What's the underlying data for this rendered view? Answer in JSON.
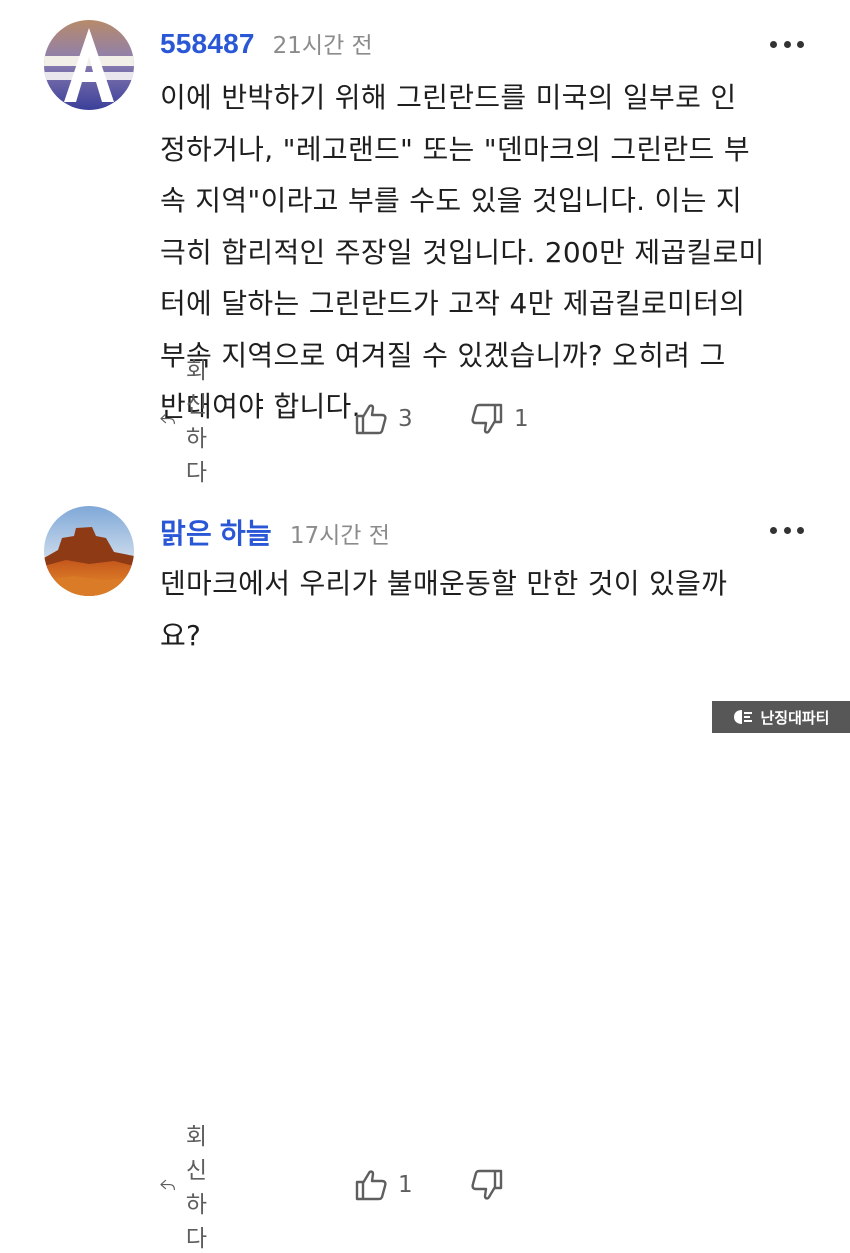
{
  "comments": [
    {
      "username": "558487",
      "time": "21시간 전",
      "text": "이에 반박하기 위해 그린란드를 미국의 일부로 인\n정하거나, \"레고랜드\" 또는 \"덴마크의 그린란드 부\n속 지역\"이라고 부를 수도 있을 것입니다. 이는 지\n극히 합리적인 주장일 것입니다. 200만 제곱킬로미\n터에 달하는 그린란드가 고작 4만 제곱킬로미터의\n부속 지역으로 여겨질 수 있겠습니까? 오히려 그\n반대여야 합니다.",
      "reply_label": "회신하다",
      "likes": "3",
      "dislikes": "1"
    },
    {
      "username": "맑은 하늘",
      "time": "17시간 전",
      "text": "덴마크에서 우리가 불매운동할 만한 것이 있을까\n요?",
      "reply_label": "회신하다",
      "likes": "1",
      "dislikes": ""
    }
  ],
  "icons": {
    "more": "more-dots-icon",
    "reply": "reply-arrow-icon",
    "like": "thumbs-up-icon",
    "dislike": "thumbs-down-icon"
  },
  "watermark": "난징대파티",
  "colors": {
    "username": "#2a57d6",
    "timestamp": "#8b8b8b",
    "action": "#5e5e5e"
  }
}
